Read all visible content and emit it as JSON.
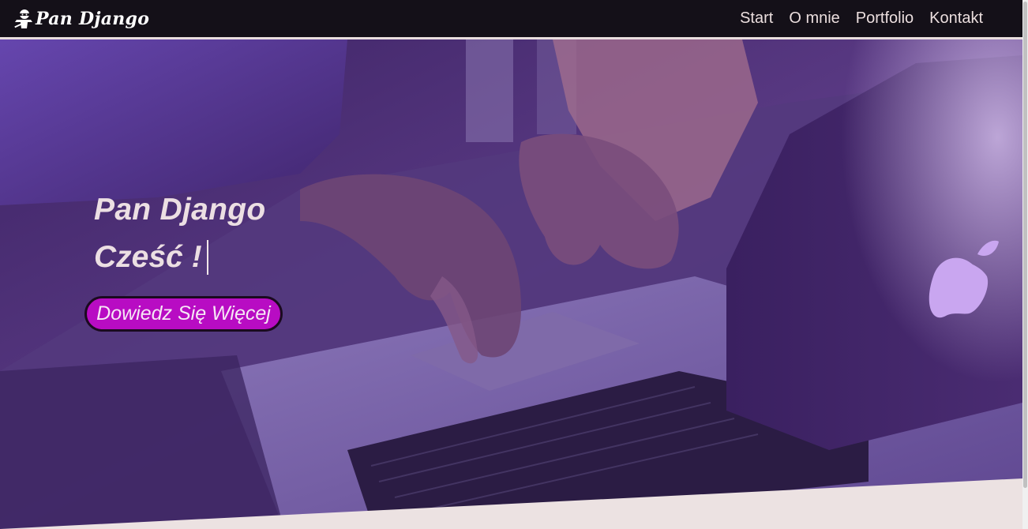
{
  "navbar": {
    "brand": "Pan Django",
    "links": [
      "Start",
      "O mnie",
      "Portfolio",
      "Kontakt"
    ]
  },
  "hero": {
    "title": "Pan Django",
    "typed_text": "Cześć !",
    "cta_label": "Dowiedz Się Więcej"
  },
  "icons": {
    "brand_icon": "ninja-icon"
  },
  "colors": {
    "navbar_bg": "#141018",
    "hero_overlay": "#4a2a6c",
    "cta_bg": "#b80cc3",
    "section_bg": "#ece2e2"
  }
}
